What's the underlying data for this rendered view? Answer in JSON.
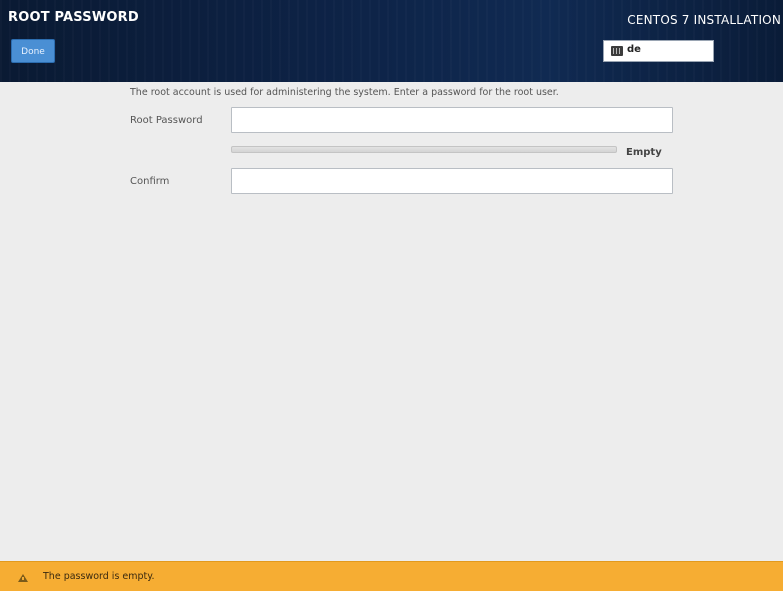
{
  "header": {
    "title": "ROOT PASSWORD",
    "done_label": "Done",
    "product": "CENTOS 7 INSTALLATION",
    "keyboard_layout": "de",
    "keyboard_icon": "keyboard-icon"
  },
  "form": {
    "description": "The root account is used for administering the system.  Enter a password for the root user.",
    "root_password_label": "Root Password",
    "root_password_value": "",
    "confirm_label": "Confirm",
    "confirm_value": "",
    "strength_label": "Empty",
    "strength_level": 0
  },
  "status": {
    "icon": "warning-icon",
    "message": "The password is empty.",
    "color": "#f6ad33"
  },
  "colors": {
    "header_bg": "#0d2245",
    "done_button": "#4a8fd4",
    "page_bg": "#ededed",
    "warning": "#f6ad33"
  }
}
